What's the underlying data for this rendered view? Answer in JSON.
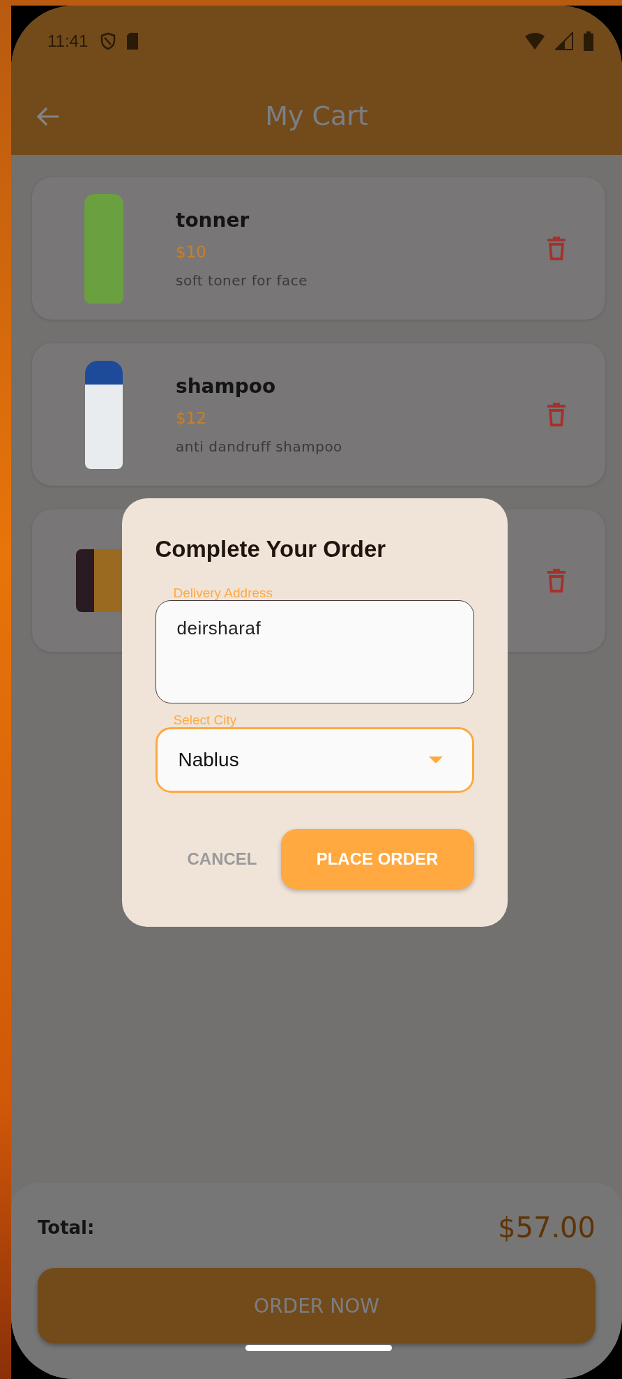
{
  "status_bar": {
    "time": "11:41"
  },
  "app_bar": {
    "title": "My Cart"
  },
  "cart_items": [
    {
      "kind": "bottle",
      "name": "tonner",
      "price": "$10",
      "description": "soft toner for face"
    },
    {
      "kind": "shampoo",
      "name": "shampoo",
      "price": "$12",
      "description": "anti dandruff shampoo"
    },
    {
      "kind": "jar"
    }
  ],
  "dialog": {
    "title": "Complete Your Order",
    "address_field": {
      "label": "Delivery Address",
      "value": "deirsharaf",
      "focused": false
    },
    "city_field": {
      "label": "Select City",
      "value": "Nablus",
      "focused": true
    },
    "cancel_button": "CANCEL",
    "place_order_button": "PLACE ORDER"
  },
  "summary": {
    "total_label": "Total:",
    "total_value": "$57.00",
    "order_button": "ORDER NOW"
  }
}
